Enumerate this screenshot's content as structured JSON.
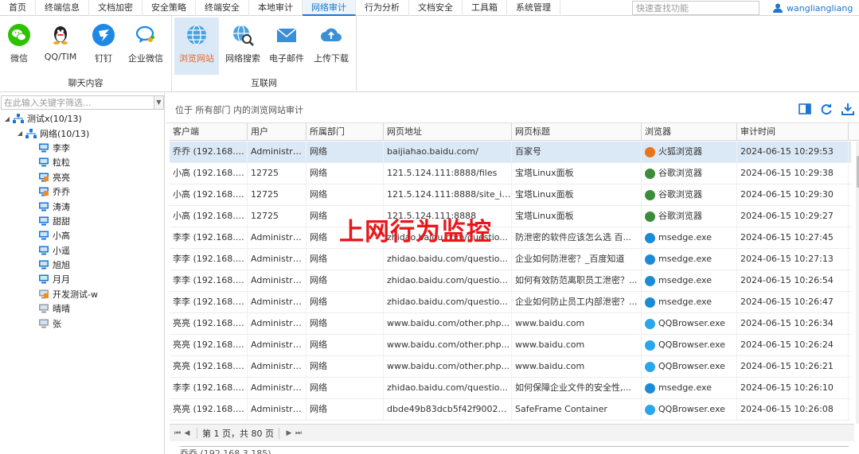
{
  "menu": [
    "首页",
    "终端信息",
    "文档加密",
    "安全策略",
    "终端安全",
    "本地审计",
    "网络审计",
    "行为分析",
    "文档安全",
    "工具箱",
    "系统管理"
  ],
  "menu_active": "网络审计",
  "quick_search_placeholder": "快速查找功能",
  "user": "wangliangliang",
  "ribbon": {
    "chat_group": "聊天内容",
    "internet_group": "互联网",
    "buttons": {
      "wechat": "微信",
      "qq": "QQ/TIM",
      "dingding": "钉钉",
      "wework": "企业微信",
      "browse": "浏览网站",
      "websearch": "网络搜索",
      "email": "电子邮件",
      "upload": "上传下载"
    }
  },
  "tree_filter_placeholder": "在此输入关键字筛选...",
  "tree": {
    "root": "测试x(10/13)",
    "group": "网络(10/13)",
    "users": [
      {
        "name": "李李",
        "status": "online"
      },
      {
        "name": "粒粒",
        "status": "online"
      },
      {
        "name": "亮亮",
        "status": "locked"
      },
      {
        "name": "乔乔",
        "status": "locked"
      },
      {
        "name": "涛涛",
        "status": "online"
      },
      {
        "name": "甜甜",
        "status": "online"
      },
      {
        "name": "小高",
        "status": "online"
      },
      {
        "name": "小遥",
        "status": "online"
      },
      {
        "name": "旭旭",
        "status": "online"
      },
      {
        "name": "月月",
        "status": "online"
      },
      {
        "name": "开发测试-w",
        "status": "locked-offline"
      },
      {
        "name": "晴晴",
        "status": "offline"
      },
      {
        "name": "张",
        "status": "offline"
      }
    ]
  },
  "path_text": "位于 所有部门 内的浏览网站审计",
  "columns": [
    "客户端",
    "用户",
    "所属部门",
    "网页地址",
    "网页标题",
    "浏览器",
    "审计时间"
  ],
  "rows": [
    [
      "乔乔 (192.168.3...",
      "Administra...",
      "网络",
      "baijiahao.baidu.com/",
      "百家号",
      "火狐浏览器",
      "2024-06-15 10:29:53"
    ],
    [
      "小高 (192.168.3...",
      "12725",
      "网络",
      "121.5.124.111:8888/files",
      "宝塔Linux面板",
      "谷歌浏览器",
      "2024-06-15 10:29:38"
    ],
    [
      "小高 (192.168.3...",
      "12725",
      "网络",
      "121.5.124.111:8888/site_ita...",
      "宝塔Linux面板",
      "谷歌浏览器",
      "2024-06-15 10:29:30"
    ],
    [
      "小高 (192.168.3...",
      "12725",
      "网络",
      "121.5.124.111:8888",
      "宝塔Linux面板",
      "谷歌浏览器",
      "2024-06-15 10:29:27"
    ],
    [
      "李李 (192.168.3...",
      "Administra...",
      "网络",
      "zhidao.baidu.com/questio...",
      "防泄密的软件应该怎么选 百...",
      "msedge.exe",
      "2024-06-15 10:27:45"
    ],
    [
      "李李 (192.168.3...",
      "Administra...",
      "网络",
      "zhidao.baidu.com/questio...",
      "企业如何防泄密？_百度知道",
      "msedge.exe",
      "2024-06-15 10:27:13"
    ],
    [
      "李李 (192.168.3...",
      "Administra...",
      "网络",
      "zhidao.baidu.com/questio...",
      "如何有效防范离职员工泄密？...",
      "msedge.exe",
      "2024-06-15 10:26:54"
    ],
    [
      "李李 (192.168.3...",
      "Administra...",
      "网络",
      "zhidao.baidu.com/questio...",
      "企业如何防止员工内部泄密？...",
      "msedge.exe",
      "2024-06-15 10:26:47"
    ],
    [
      "亮亮 (192.168.3...",
      "Administra...",
      "网络",
      "www.baidu.com/other.php...",
      "www.baidu.com",
      "QQBrowser.exe",
      "2024-06-15 10:26:34"
    ],
    [
      "亮亮 (192.168.3...",
      "Administra...",
      "网络",
      "www.baidu.com/other.php...",
      "www.baidu.com",
      "QQBrowser.exe",
      "2024-06-15 10:26:24"
    ],
    [
      "亮亮 (192.168.3...",
      "Administra...",
      "网络",
      "www.baidu.com/other.php...",
      "www.baidu.com",
      "QQBrowser.exe",
      "2024-06-15 10:26:21"
    ],
    [
      "李李 (192.168.3...",
      "Administra...",
      "网络",
      "zhidao.baidu.com/questio...",
      "如何保障企业文件的安全性,...",
      "msedge.exe",
      "2024-06-15 10:26:10"
    ],
    [
      "亮亮 (192.168.3...",
      "Administra...",
      "网络",
      "dbde49b83dcb5f42f9002d...",
      "SafeFrame Container",
      "QQBrowser.exe",
      "2024-06-15 10:26:08"
    ]
  ],
  "browser_colors": {
    "火狐浏览器": "#e8751a",
    "谷歌浏览器": "#3c8c3c",
    "msedge.exe": "#1b8bd6",
    "QQBrowser.exe": "#2aa7e8"
  },
  "pager_text": "第 1 页，共 80 页",
  "status_text": "乔乔 (192.168.3.185)",
  "overlay_text": "上网行为监控"
}
